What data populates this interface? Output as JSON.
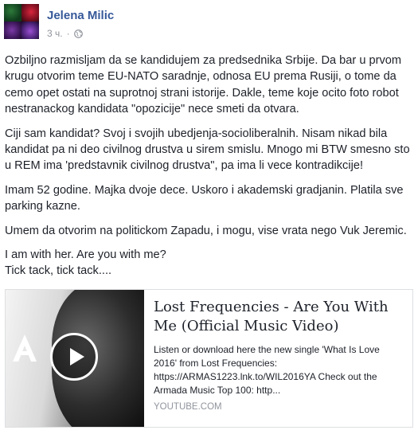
{
  "author": {
    "name": "Jelena Milic"
  },
  "meta": {
    "time": "3 ч.",
    "separator": "·",
    "audience_icon": "globe-icon"
  },
  "post": {
    "paragraphs": [
      "Ozbiljno razmisljam da se kandidujem za predsednika Srbije. Da bar u prvom krugu otvorim teme EU-NATO saradnje, odnosa EU prema Rusiji, o tome da cemo opet ostati na suprotnoj strani istorije. Dakle, teme koje ocito foto robot nestranackog kandidata \"opozicije\" nece smeti da otvara.",
      "Ciji sam kandidat? Svoj i svojih ubedjenja-socioliberalnih. Nisam nikad bila kandidat pa ni deo civilnog drustva u sirem smislu. Mnogo mi BTW smesno sto u REM ima 'predstavnik civilnog drustva\", pa ima li vece kontradikcije!",
      "Imam 52 godine. Majka dvoje dece. Uskoro i akademski gradjanin. Platila sve parking kazne.",
      "Umem da otvorim na politickom Zapadu, i mogu, vise vrata nego Vuk Jeremic.",
      "I am with her. Are you with me?",
      "Tick tack, tick tack...."
    ]
  },
  "link_card": {
    "title": "Lost Frequencies - Are You With Me (Official Music Video)",
    "description": "Listen or download here the new single 'What Is Love 2016' from Lost Frequencies: https://ARMAS1223.lnk.to/WIL2016YA Check out the Armada Music Top 100: http...",
    "domain": "YOUTUBE.COM",
    "thumbnail_icons": [
      "armada-logo-icon",
      "play-icon"
    ]
  }
}
